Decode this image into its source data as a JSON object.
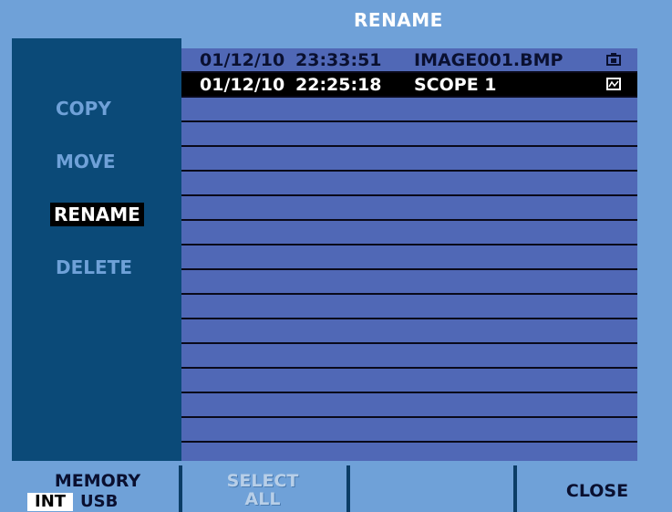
{
  "title": "RENAME",
  "actions": {
    "copy": "COPY",
    "move": "MOVE",
    "rename": "RENAME",
    "delete": "DELETE"
  },
  "files": [
    {
      "date": "01/12/10",
      "time": "23:33:51",
      "name": "IMAGE001.BMP",
      "icon": "camera-icon"
    },
    {
      "date": "01/12/10",
      "time": "22:25:18",
      "name": "SCOPE 1",
      "icon": "waveform-icon"
    }
  ],
  "softkeys": {
    "memory": {
      "label": "MEMORY",
      "options": [
        "INT",
        "USB"
      ],
      "active": "INT"
    },
    "select_all": "SELECT\nALL",
    "empty": "",
    "close": "CLOSE"
  },
  "colors": {
    "background": "#6fa1d8",
    "panel": "#0b4a78",
    "file_area": "#5068b6",
    "selection": "#000000"
  }
}
